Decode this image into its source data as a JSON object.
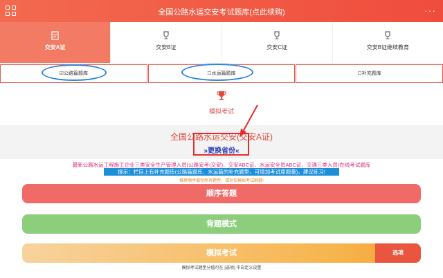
{
  "header": {
    "title": "全国公路水运交安考试题库(点此续购)",
    "more_label": "···"
  },
  "tabs": [
    {
      "label": "交安A证",
      "icon": "edit-icon"
    },
    {
      "label": "交安B证",
      "icon": "trophy-icon"
    },
    {
      "label": "交安C证",
      "icon": "trophy-icon"
    },
    {
      "label": "交安B证继续教育",
      "icon": "trophy-icon"
    }
  ],
  "subtabs": [
    "☑公路篇题库",
    "☐水运篇题库",
    "☐补充题库"
  ],
  "mock": {
    "label": "模拟考试"
  },
  "info": {
    "title": "全国公路水运交安(交安A证)",
    "switch": "»更换省份«"
  },
  "desc": "最新公路水运工程施工企业三类安全生产管理人员(公路安考(交安)、交安ABC证、水运安全员ABC证、交通三类人员)在线考试题库",
  "tip": "提示：栏目上有补充题库(公路篇题库、水运篇的补充题型，可增加考试原题量)，建议练习!",
  "note": "推荐顺序做完所有题型，请勿仅模拟考试刷题!",
  "buttons": {
    "sequence": "顺序答题",
    "memorize": "背题模式",
    "mock": "模拟考试",
    "options": "选项"
  },
  "footer": "模拟考试题型分值可在 [选项] 中自定义设置",
  "colors": {
    "brand": "#f04c3d",
    "annotation_blue": "#2a84e0",
    "annotation_red": "#e62c2c"
  }
}
